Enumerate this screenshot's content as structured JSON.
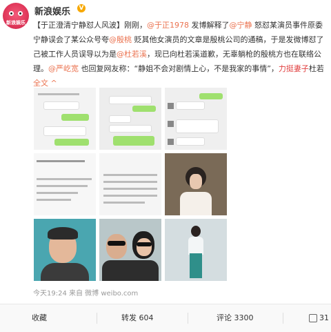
{
  "post": {
    "author": "新浪娱乐",
    "verified_badge": "V",
    "avatar_text": "新浪娱乐",
    "text_lines": [
      {
        "segments": [
          {
            "text": "【于正澄清宁静怼人风波】刚刚，",
            "style": "plain"
          },
          {
            "text": "@于正1978",
            "style": "link"
          },
          {
            "text": " 发博解释了",
            "style": "plain"
          },
          {
            "text": "@宁静",
            "style": "link"
          },
          {
            "text": " 怒怼某演员事件原委",
            "style": "plain"
          }
        ]
      },
      {
        "segments": [
          {
            "text": "宁静误会了某公众号夸",
            "style": "plain"
          },
          {
            "text": "@殷桃",
            "style": "link"
          },
          {
            "text": " 贬其他女演员的文章是殷桃公司的通稿，于是发微博怼了",
            "style": "plain"
          }
        ]
      },
      {
        "segments": [
          {
            "text": "己被工作人员误导以为是",
            "style": "plain"
          },
          {
            "text": "@杜若溪",
            "style": "link"
          },
          {
            "text": "，现已向杜若溪道歉，无辜躺枪的殷桃方也在联络公",
            "style": "plain"
          }
        ]
      },
      {
        "segments": [
          {
            "text": "理。",
            "style": "plain"
          },
          {
            "text": "@严屹宽",
            "style": "link"
          },
          {
            "text": " 也回复网友称：“静姐不会对剧情上心，不是我家的事情”，",
            "style": "plain"
          },
          {
            "text": "力挺妻子",
            "style": "red"
          },
          {
            "text": "杜若",
            "style": "plain"
          }
        ]
      },
      {
        "segments": [
          {
            "text": "全文 ^",
            "style": "link"
          }
        ]
      }
    ],
    "timestamp": "今天19:24 来自 微博 weibo.com"
  },
  "images": [
    {
      "name": "chat-screenshot-1"
    },
    {
      "name": "chat-screenshot-2"
    },
    {
      "name": "chat-screenshot-3"
    },
    {
      "name": "comment-screenshot-1"
    },
    {
      "name": "comment-screenshot-2"
    },
    {
      "name": "photo-woman-dark-hair"
    },
    {
      "name": "photo-man-selfie"
    },
    {
      "name": "photo-couple-sunglasses"
    },
    {
      "name": "photo-woman-standing"
    }
  ],
  "actions": {
    "favorite": "收藏",
    "repost": "转发 604",
    "comment": "评论 3300",
    "like": "31"
  },
  "colors": {
    "link": "#eb7350",
    "highlight": "#e03c3c",
    "verified": "#f7a800"
  }
}
